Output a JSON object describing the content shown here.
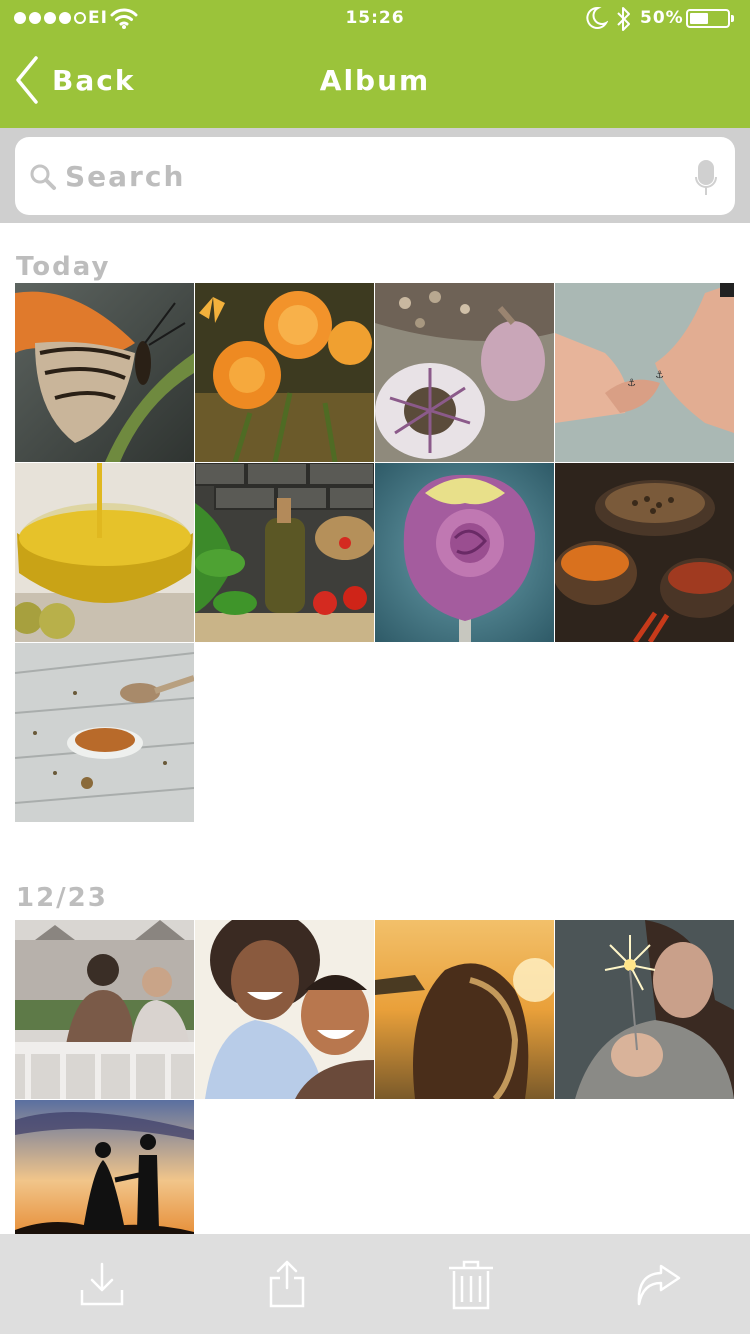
{
  "status_bar": {
    "signal": "●●●●○",
    "carrier": "EI",
    "time": "15:26",
    "battery_percent": "50%",
    "battery_level": 0.5
  },
  "nav": {
    "back_label": "Back",
    "title": "Album"
  },
  "search": {
    "placeholder": "Search",
    "value": ""
  },
  "sections": [
    {
      "title": "Today",
      "photos": [
        "butterfly",
        "orange-flowers",
        "garlic",
        "linked-fingers",
        "olive-oil",
        "basil-oil-tomatoes",
        "purple-rose",
        "spice-bowls",
        "spice-spoon"
      ]
    },
    {
      "title": "12/23",
      "photos": [
        "couple-on-bench",
        "happy-couple",
        "woman-at-sunset",
        "sparkler",
        "wedding-silhouette"
      ]
    }
  ],
  "toolbar": {
    "items": [
      "download-icon",
      "share-icon",
      "trash-icon",
      "forward-icon"
    ]
  },
  "colors": {
    "accent": "#9bc33a",
    "search_bg": "#cfcfcf",
    "toolbar_bg": "#dedede",
    "section_title": "#bdbdbd",
    "icon_light": "#ffffff"
  }
}
